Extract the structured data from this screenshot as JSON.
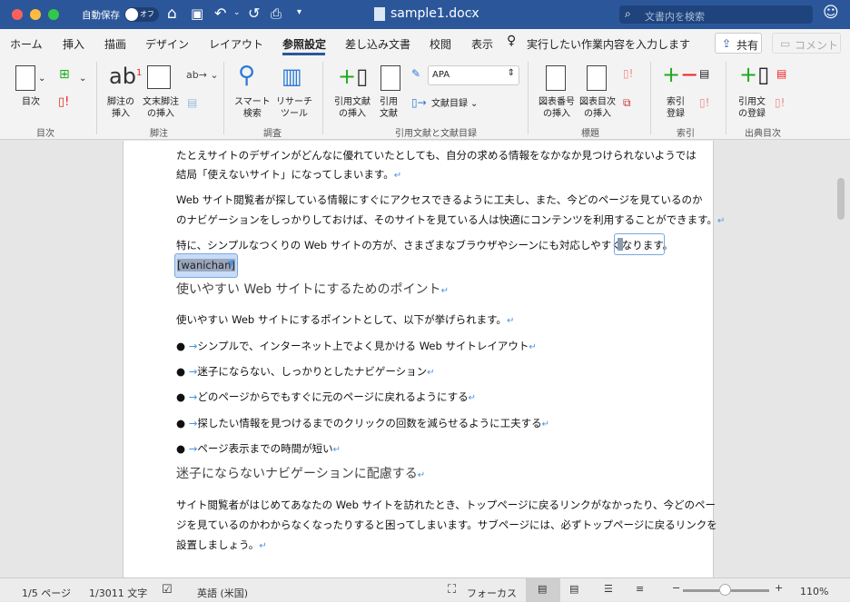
{
  "titlebar": {
    "autosave_label": "自動保存",
    "autosave_state": "オフ",
    "filename": "sample1.docx",
    "search_placeholder": "文書内を検索"
  },
  "tabs": [
    "ホーム",
    "挿入",
    "描画",
    "デザイン",
    "レイアウト",
    "参照設定",
    "差し込み文書",
    "校閲",
    "表示"
  ],
  "active_tab": "参照設定",
  "tell_me": "実行したい作業内容を入力します",
  "share_label": "共有",
  "comment_label": "コメント",
  "ribbon": {
    "toc": {
      "toc_label": "目次",
      "group": "目次"
    },
    "footnotes": {
      "insert_footnote": "脚注の\n挿入",
      "insert_endnote": "文末脚注\nの挿入",
      "group": "脚注"
    },
    "research": {
      "smart_lookup": "スマート\n検索",
      "researcher": "リサーチ\nツール",
      "group": "調査"
    },
    "citations": {
      "insert_citation": "引用文献\nの挿入",
      "citations": "引用\n文献",
      "style": "APA",
      "bibliography": "文献目録",
      "group": "引用文献と文献目録"
    },
    "captions": {
      "insert_caption": "図表番号\nの挿入",
      "insert_tof": "図表目次\nの挿入",
      "group": "標題"
    },
    "index": {
      "mark_entry": "索引\n登録",
      "group": "索引"
    },
    "toa": {
      "mark_citation": "引用文\nの登録",
      "group": "出典目次"
    }
  },
  "document": {
    "p1": [
      "たとえサイトのデザインがどんなに優れていたとしても、自分の求める情報をなかなか見つけられないようでは",
      "結局「使えないサイト」になってしまいます。"
    ],
    "p2": [
      "Web サイト閲覧者が探している情報にすぐにアクセスできるように工夫し、また、今どのページを見ているのか",
      "のナビゲーションをしっかりしておけば、そのサイトを見ている人は快適にコンテンツを利用することができます。"
    ],
    "p3": "特に、シンプルなつくりの Web サイトの方が、さまざまなブラウザやシーンにも対応しやすくなります。",
    "comment_author": "[wanichan]",
    "heading1": "使いやすい Web サイトにするためのポイント",
    "p4": "使いやすい Web サイトにするポイントとして、以下が挙げられます。",
    "bullets": [
      "シンプルで、インターネット上でよく見かける Web サイトレイアウト",
      "迷子にならない、しっかりとしたナビゲーション",
      "どのページからでもすぐに元のページに戻れるようにする",
      "探したい情報を見つけるまでのクリックの回数を減らせるように工夫する",
      "ページ表示までの時間が短い"
    ],
    "heading2": "迷子にならないナビゲーションに配慮する",
    "p5": [
      "サイト閲覧者がはじめてあなたの Web サイトを訪れたとき、トップページに戻るリンクがなかったり、今どのペー",
      "ジを見ているのかわからなくなったりすると困ってしまいます。サブページには、必ずトップページに戻るリンクを",
      "設置しましょう。"
    ]
  },
  "status": {
    "page": "1/5 ページ",
    "words": "1/3011 文字",
    "language": "英語 (米国)",
    "focus": "フォーカス",
    "zoom": "110%",
    "zoom_level_percent": 110
  },
  "colors": {
    "titlebar": "#2b579a",
    "accent": "#2b579a",
    "pilcrow": "#4a90e2"
  }
}
